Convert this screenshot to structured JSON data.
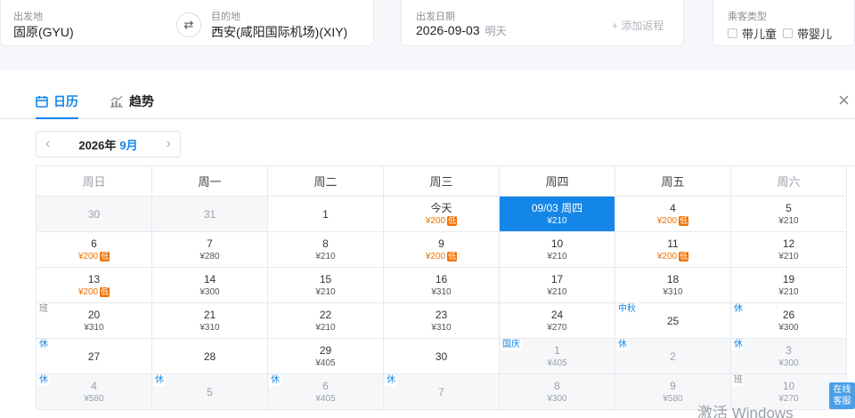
{
  "search": {
    "from_label": "出发地",
    "from_value": "固原(GYU)",
    "to_label": "目的地",
    "to_value": "西安(咸阳国际机场)(XIY)",
    "swap_icon": "⇄",
    "date_label": "出发日期",
    "date_value": "2026-09-03",
    "date_weekday": "明天",
    "return_label": "+ 添加返程",
    "passenger_label": "乘客类型",
    "child_label": "带儿童",
    "infant_label": "带婴儿"
  },
  "tabs": {
    "calendar": "日历",
    "trend": "趋势",
    "close": "×"
  },
  "month_nav": {
    "prev": "‹",
    "year": "2026年",
    "month": "9月",
    "next": "›"
  },
  "weekdays": [
    "周日",
    "周一",
    "周二",
    "周三",
    "周四",
    "周五",
    "周六"
  ],
  "weeks": [
    [
      {
        "day": "30",
        "price": "",
        "low": false,
        "other": true,
        "sel": false,
        "tag": ""
      },
      {
        "day": "31",
        "price": "",
        "low": false,
        "other": true,
        "sel": false,
        "tag": ""
      },
      {
        "day": "1",
        "price": "",
        "low": false,
        "other": false,
        "sel": false,
        "tag": ""
      },
      {
        "day": "今天",
        "price": "¥200",
        "low": true,
        "other": false,
        "sel": false,
        "tag": ""
      },
      {
        "day": "09/03 周四",
        "price": "¥210",
        "low": false,
        "other": false,
        "sel": true,
        "tag": ""
      },
      {
        "day": "4",
        "price": "¥200",
        "low": true,
        "other": false,
        "sel": false,
        "tag": ""
      },
      {
        "day": "5",
        "price": "¥210",
        "low": false,
        "other": false,
        "sel": false,
        "tag": ""
      }
    ],
    [
      {
        "day": "6",
        "price": "¥200",
        "low": true,
        "other": false,
        "sel": false,
        "tag": ""
      },
      {
        "day": "7",
        "price": "¥280",
        "low": false,
        "other": false,
        "sel": false,
        "tag": ""
      },
      {
        "day": "8",
        "price": "¥210",
        "low": false,
        "other": false,
        "sel": false,
        "tag": ""
      },
      {
        "day": "9",
        "price": "¥200",
        "low": true,
        "other": false,
        "sel": false,
        "tag": ""
      },
      {
        "day": "10",
        "price": "¥210",
        "low": false,
        "other": false,
        "sel": false,
        "tag": ""
      },
      {
        "day": "11",
        "price": "¥200",
        "low": true,
        "other": false,
        "sel": false,
        "tag": ""
      },
      {
        "day": "12",
        "price": "¥210",
        "low": false,
        "other": false,
        "sel": false,
        "tag": ""
      }
    ],
    [
      {
        "day": "13",
        "price": "¥200",
        "low": true,
        "other": false,
        "sel": false,
        "tag": ""
      },
      {
        "day": "14",
        "price": "¥300",
        "low": false,
        "other": false,
        "sel": false,
        "tag": ""
      },
      {
        "day": "15",
        "price": "¥210",
        "low": false,
        "other": false,
        "sel": false,
        "tag": ""
      },
      {
        "day": "16",
        "price": "¥310",
        "low": false,
        "other": false,
        "sel": false,
        "tag": ""
      },
      {
        "day": "17",
        "price": "¥210",
        "low": false,
        "other": false,
        "sel": false,
        "tag": ""
      },
      {
        "day": "18",
        "price": "¥310",
        "low": false,
        "other": false,
        "sel": false,
        "tag": ""
      },
      {
        "day": "19",
        "price": "¥210",
        "low": false,
        "other": false,
        "sel": false,
        "tag": ""
      }
    ],
    [
      {
        "day": "20",
        "price": "¥310",
        "low": false,
        "other": false,
        "sel": false,
        "tag": "班"
      },
      {
        "day": "21",
        "price": "¥310",
        "low": false,
        "other": false,
        "sel": false,
        "tag": ""
      },
      {
        "day": "22",
        "price": "¥210",
        "low": false,
        "other": false,
        "sel": false,
        "tag": ""
      },
      {
        "day": "23",
        "price": "¥310",
        "low": false,
        "other": false,
        "sel": false,
        "tag": ""
      },
      {
        "day": "24",
        "price": "¥270",
        "low": false,
        "other": false,
        "sel": false,
        "tag": ""
      },
      {
        "day": "25",
        "price": "",
        "low": false,
        "other": false,
        "sel": false,
        "tag": "中秋"
      },
      {
        "day": "26",
        "price": "¥300",
        "low": false,
        "other": false,
        "sel": false,
        "tag": "休"
      }
    ],
    [
      {
        "day": "27",
        "price": "",
        "low": false,
        "other": false,
        "sel": false,
        "tag": "休"
      },
      {
        "day": "28",
        "price": "",
        "low": false,
        "other": false,
        "sel": false,
        "tag": ""
      },
      {
        "day": "29",
        "price": "¥405",
        "low": false,
        "other": false,
        "sel": false,
        "tag": ""
      },
      {
        "day": "30",
        "price": "",
        "low": false,
        "other": false,
        "sel": false,
        "tag": ""
      },
      {
        "day": "1",
        "price": "¥405",
        "low": false,
        "other": true,
        "sel": false,
        "tag": "国庆"
      },
      {
        "day": "2",
        "price": "",
        "low": false,
        "other": true,
        "sel": false,
        "tag": "休"
      },
      {
        "day": "3",
        "price": "¥300",
        "low": false,
        "other": true,
        "sel": false,
        "tag": "休"
      }
    ],
    [
      {
        "day": "4",
        "price": "¥580",
        "low": false,
        "other": true,
        "sel": false,
        "tag": "休"
      },
      {
        "day": "5",
        "price": "",
        "low": false,
        "other": true,
        "sel": false,
        "tag": "休"
      },
      {
        "day": "6",
        "price": "¥405",
        "low": false,
        "other": true,
        "sel": false,
        "tag": "休"
      },
      {
        "day": "7",
        "price": "",
        "low": false,
        "other": true,
        "sel": false,
        "tag": "休"
      },
      {
        "day": "8",
        "price": "¥300",
        "low": false,
        "other": true,
        "sel": false,
        "tag": ""
      },
      {
        "day": "9",
        "price": "¥580",
        "low": false,
        "other": true,
        "sel": false,
        "tag": ""
      },
      {
        "day": "10",
        "price": "¥270",
        "low": false,
        "other": true,
        "sel": false,
        "tag": "班"
      }
    ]
  ],
  "low_label": "低",
  "watermark": "激活 Windows",
  "customer_service": "在线客服",
  "colors": {
    "accent": "#1486e8",
    "low_price": "#f07000",
    "border": "#e7e9ee"
  }
}
